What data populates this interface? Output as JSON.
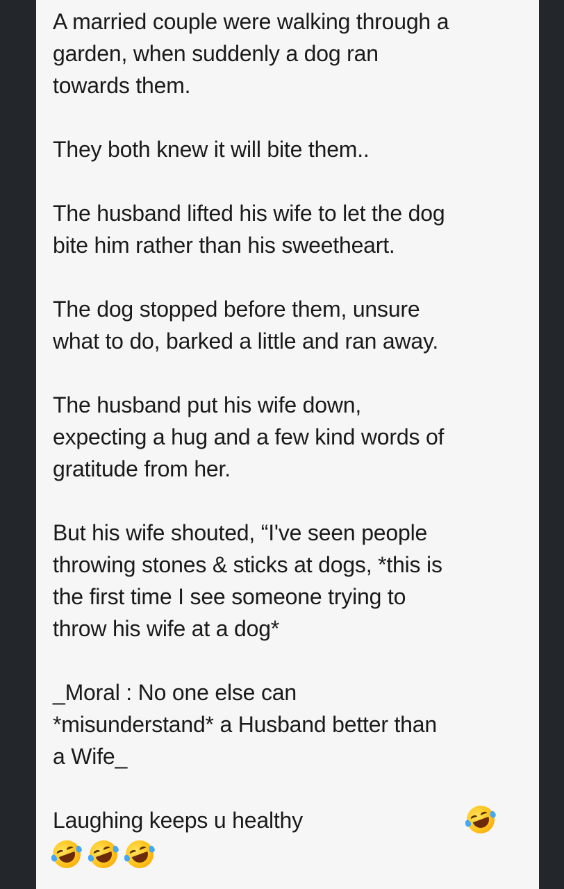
{
  "post": {
    "paragraphs": [
      "A married couple were walking through a\ngarden, when suddenly a dog ran\ntowards them.",
      "They both knew it will bite them..",
      "The husband lifted his wife to let the dog\nbite him rather than his sweetheart.",
      "The dog stopped before them, unsure\nwhat to do, barked a little and ran away.",
      "The husband put his wife down,\nexpecting a hug and a few kind words of\ngratitude from her.",
      "But his wife shouted, “I've seen people\nthrowing stones & sticks at dogs, *this is\nthe first time I see someone trying to\nthrow his wife at a dog*",
      "_Moral : No one else can\n*misunderstand* a Husband better than\na Wife_"
    ],
    "closing_line": "Laughing keeps u healthy",
    "emojis": [
      "rolling-on-floor-laughing",
      "rolling-on-floor-laughing",
      "rolling-on-floor-laughing",
      "rolling-on-floor-laughing"
    ]
  },
  "colors": {
    "background": "#23262b",
    "card": "#f6f6f6",
    "text": "#1a1a1a"
  }
}
